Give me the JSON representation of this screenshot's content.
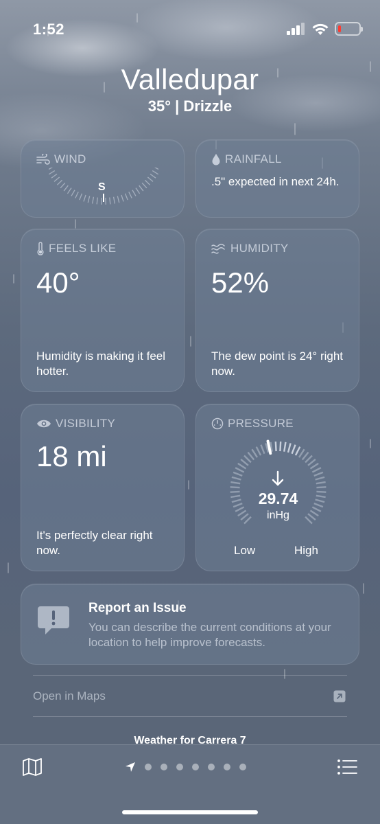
{
  "status": {
    "time": "1:52"
  },
  "header": {
    "city": "Valledupar",
    "summary": "35° | Drizzle"
  },
  "wind": {
    "title": "WIND",
    "direction": "S"
  },
  "rainfall": {
    "title": "RAINFALL",
    "text": ".5\" expected in next 24h."
  },
  "feels_like": {
    "title": "FEELS LIKE",
    "value": "40°",
    "text": "Humidity is making it feel hotter."
  },
  "humidity": {
    "title": "HUMIDITY",
    "value": "52%",
    "text": "The dew point is 24° right now."
  },
  "visibility": {
    "title": "VISIBILITY",
    "value": "18 mi",
    "text": "It's perfectly clear right now."
  },
  "pressure": {
    "title": "PRESSURE",
    "value": "29.74",
    "unit": "inHg",
    "low_label": "Low",
    "high_label": "High"
  },
  "report": {
    "title": "Report an Issue",
    "text": "You can describe the current conditions at your location to help improve forecasts."
  },
  "maps": {
    "label": "Open in Maps"
  },
  "bottom": {
    "location": "Weather for Carrera 7",
    "page_dots": 7
  },
  "icons": {
    "wind": "wind-icon",
    "rainfall": "raindrop-icon",
    "feels_like": "thermometer-icon",
    "humidity": "humidity-icon",
    "visibility": "eye-icon",
    "pressure": "gauge-icon",
    "report": "exclamation-bubble-icon",
    "maps": "external-link-icon",
    "map": "map-icon",
    "list": "list-icon",
    "location": "location-arrow-icon"
  },
  "colors": {
    "battery_low": "#ff3b30"
  }
}
